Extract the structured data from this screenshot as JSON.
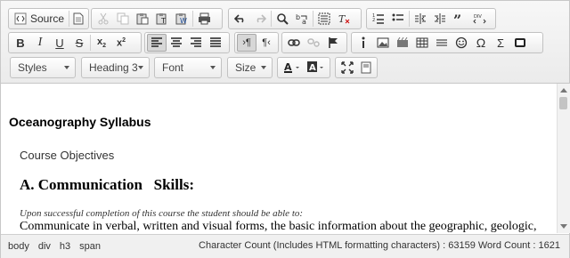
{
  "toolbar": {
    "source_label": "Source",
    "styles_label": "Styles",
    "format_label": "Heading 3",
    "font_label": "Font",
    "size_label": "Size"
  },
  "content": {
    "title": "Oceanography Syllabus",
    "objectives": "Course Objectives",
    "heading": "A. Communication   Skills:",
    "intro": "Upon successful completion of this course the student should be able to:",
    "paragraph": "Communicate in verbal, written and visual forms, the basic information about the geographic, geologic,"
  },
  "status": {
    "path": [
      "body",
      "div",
      "h3",
      "span"
    ],
    "counts": "Character Count (Includes HTML formatting characters) : 63159 Word Count : 1621"
  },
  "icons": [
    "source-icon",
    "document-icon",
    "cut-icon",
    "copy-icon",
    "paste-icon",
    "paste-text-icon",
    "paste-word-icon",
    "print-icon",
    "undo-icon",
    "redo-icon",
    "find-icon",
    "replace-icon",
    "select-all-icon",
    "remove-format-icon",
    "numbered-list-icon",
    "bulleted-list-icon",
    "outdent-icon",
    "indent-icon",
    "blockquote-icon",
    "div-icon",
    "bold-icon",
    "italic-icon",
    "underline-icon",
    "strikethrough-icon",
    "subscript-icon",
    "superscript-icon",
    "align-left-icon",
    "align-center-icon",
    "align-right-icon",
    "justify-icon",
    "ltr-icon",
    "rtl-icon",
    "link-icon",
    "unlink-icon",
    "anchor-icon",
    "info-icon",
    "image-icon",
    "flash-icon",
    "table-icon",
    "horizontal-line-icon",
    "smiley-icon",
    "special-char-icon",
    "sigma-icon",
    "iframe-icon",
    "text-color-icon",
    "bg-color-icon",
    "maximize-icon",
    "show-blocks-icon"
  ]
}
